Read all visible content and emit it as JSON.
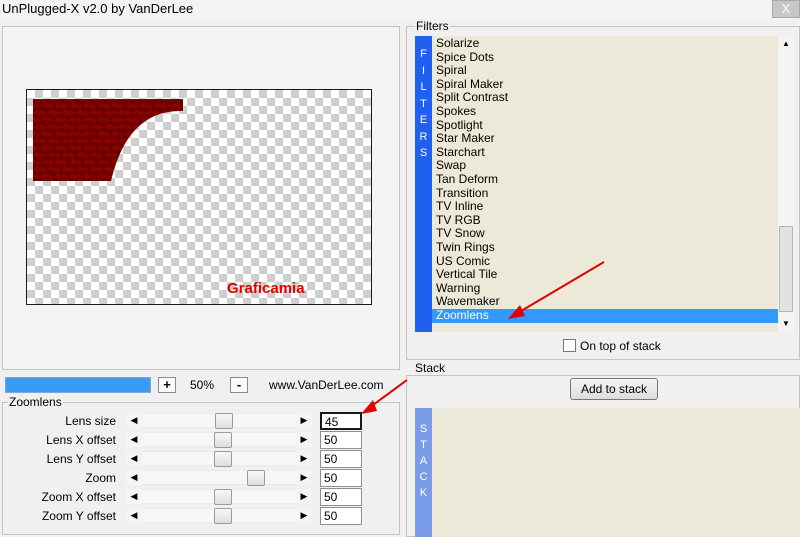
{
  "window": {
    "title": "UnPlugged-X v2.0 by VanDerLee",
    "close_symbol": "X"
  },
  "preview": {
    "watermark": "Graficamia",
    "zoom_minus": "-",
    "zoom_plus": "+",
    "zoom_value": "50%",
    "website": "www.VanDerLee.com",
    "progress_fraction": 1.0
  },
  "params": {
    "group_title": "Zoomlens",
    "rows": [
      {
        "label": "Lens size",
        "value": "45"
      },
      {
        "label": "Lens X offset",
        "value": "50"
      },
      {
        "label": "Lens Y offset",
        "value": "50"
      },
      {
        "label": "Zoom",
        "value": "50"
      },
      {
        "label": "Zoom X offset",
        "value": "50"
      },
      {
        "label": "Zoom Y offset",
        "value": "50"
      }
    ]
  },
  "filters": {
    "group_title": "Filters",
    "tab_letters": [
      "F",
      "I",
      "L",
      "T",
      "E",
      "R",
      "S"
    ],
    "items": [
      "Solarize",
      "Spice Dots",
      "Spiral",
      "Spiral Maker",
      "Split Contrast",
      "Spokes",
      "Spotlight",
      "Star Maker",
      "Starchart",
      "Swap",
      "Tan Deform",
      "Transition",
      "TV Inline",
      "TV RGB",
      "TV Snow",
      "Twin Rings",
      "US Comic",
      "Vertical Tile",
      "Warning",
      "Wavemaker",
      "Zoomlens"
    ],
    "selected": "Zoomlens",
    "on_top_label": "On top of stack",
    "on_top_checked": false
  },
  "stack": {
    "group_title": "Stack",
    "add_button": "Add to stack",
    "tab_letters": [
      "S",
      "T",
      "A",
      "C",
      "K"
    ]
  },
  "colors": {
    "selection": "#3399ff",
    "filters_tab": "#2060f0",
    "stack_tab": "#7a9ce8",
    "annotation_arrow": "#e00000"
  }
}
